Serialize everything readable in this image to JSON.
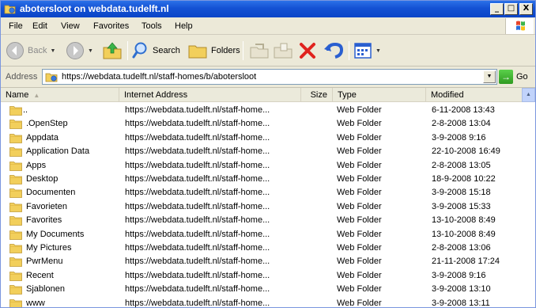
{
  "window": {
    "title": "abotersloot on webdata.tudelft.nl",
    "minimize": "_",
    "maximize": "□",
    "close": "X"
  },
  "menu": [
    "File",
    "Edit",
    "View",
    "Favorites",
    "Tools",
    "Help"
  ],
  "toolbar": {
    "back": "Back",
    "search": "Search",
    "folders": "Folders"
  },
  "address": {
    "label": "Address",
    "value": "https://webdata.tudelft.nl/staff-homes/b/abotersloot",
    "go": "Go"
  },
  "columns": {
    "name": "Name",
    "internet_address": "Internet Address",
    "size": "Size",
    "type": "Type",
    "modified": "Modified"
  },
  "rows": [
    {
      "name": "..",
      "address": "https://webdata.tudelft.nl/staff-home...",
      "type": "Web Folder",
      "modified": "6-11-2008 13:43"
    },
    {
      "name": ".OpenStep",
      "address": "https://webdata.tudelft.nl/staff-home...",
      "type": "Web Folder",
      "modified": "2-8-2008 13:04"
    },
    {
      "name": "Appdata",
      "address": "https://webdata.tudelft.nl/staff-home...",
      "type": "Web Folder",
      "modified": "3-9-2008 9:16"
    },
    {
      "name": "Application Data",
      "address": "https://webdata.tudelft.nl/staff-home...",
      "type": "Web Folder",
      "modified": "22-10-2008 16:49"
    },
    {
      "name": "Apps",
      "address": "https://webdata.tudelft.nl/staff-home...",
      "type": "Web Folder",
      "modified": "2-8-2008 13:05"
    },
    {
      "name": "Desktop",
      "address": "https://webdata.tudelft.nl/staff-home...",
      "type": "Web Folder",
      "modified": "18-9-2008 10:22"
    },
    {
      "name": "Documenten",
      "address": "https://webdata.tudelft.nl/staff-home...",
      "type": "Web Folder",
      "modified": "3-9-2008 15:18"
    },
    {
      "name": "Favorieten",
      "address": "https://webdata.tudelft.nl/staff-home...",
      "type": "Web Folder",
      "modified": "3-9-2008 15:33"
    },
    {
      "name": "Favorites",
      "address": "https://webdata.tudelft.nl/staff-home...",
      "type": "Web Folder",
      "modified": "13-10-2008 8:49"
    },
    {
      "name": "My Documents",
      "address": "https://webdata.tudelft.nl/staff-home...",
      "type": "Web Folder",
      "modified": "13-10-2008 8:49"
    },
    {
      "name": "My Pictures",
      "address": "https://webdata.tudelft.nl/staff-home...",
      "type": "Web Folder",
      "modified": "2-8-2008 13:06"
    },
    {
      "name": "PwrMenu",
      "address": "https://webdata.tudelft.nl/staff-home...",
      "type": "Web Folder",
      "modified": "21-11-2008 17:24"
    },
    {
      "name": "Recent",
      "address": "https://webdata.tudelft.nl/staff-home...",
      "type": "Web Folder",
      "modified": "3-9-2008 9:16"
    },
    {
      "name": "Sjablonen",
      "address": "https://webdata.tudelft.nl/staff-home...",
      "type": "Web Folder",
      "modified": "3-9-2008 13:10"
    },
    {
      "name": "www",
      "address": "https://webdata.tudelft.nl/staff-home...",
      "type": "Web Folder",
      "modified": "3-9-2008 13:11"
    }
  ],
  "colors": {
    "title_bar": "#0a45c8",
    "folder": "#f2cf5b",
    "chrome": "#ece9d8"
  },
  "icons": [
    "folder-icon",
    "back-arrow-icon",
    "forward-arrow-icon",
    "up-folder-icon",
    "search-icon",
    "folders-icon",
    "move-to-icon",
    "copy-to-icon",
    "delete-icon",
    "undo-icon",
    "views-icon",
    "go-arrow-icon",
    "windows-logo-icon"
  ]
}
